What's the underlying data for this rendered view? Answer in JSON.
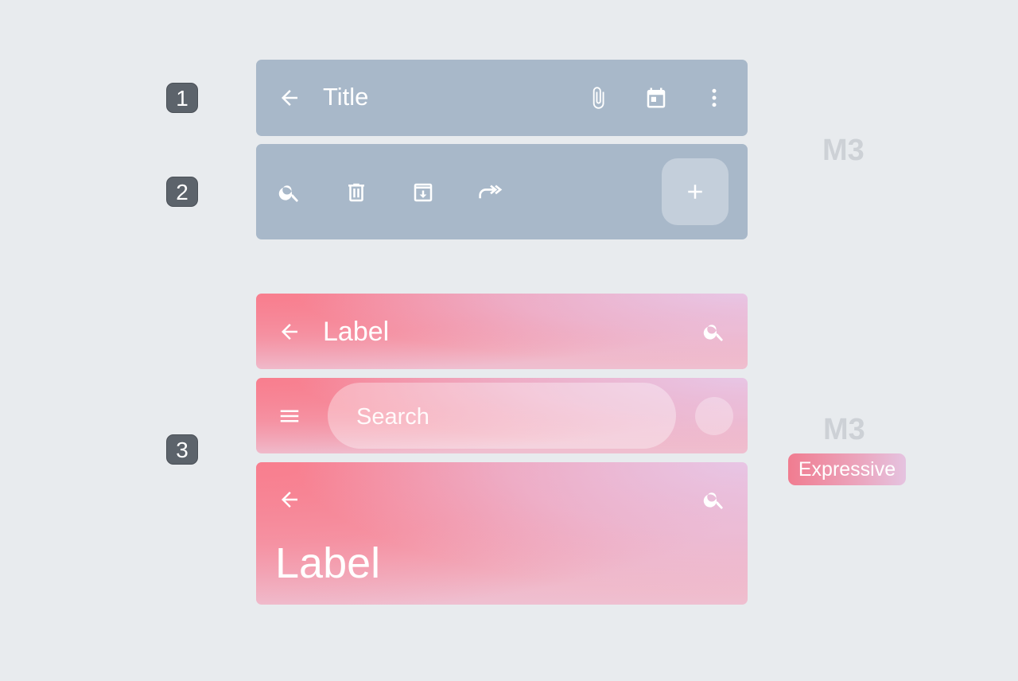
{
  "badges": [
    "1",
    "2",
    "3"
  ],
  "toolbar1": {
    "title": "Title",
    "icons": [
      "arrow-back-icon",
      "attach-icon",
      "calendar-icon",
      "more-vert-icon"
    ]
  },
  "toolbar2": {
    "icons": [
      "search-icon",
      "delete-icon",
      "archive-icon",
      "forward-icon",
      "add-icon"
    ]
  },
  "expressive": {
    "top_bar": {
      "title": "Label"
    },
    "search_bar": {
      "placeholder": "Search"
    },
    "large_bar": {
      "title": "Label"
    }
  },
  "labels": {
    "m3_top": "M3",
    "m3_bottom": "M3",
    "expressive": "Expressive"
  },
  "colors": {
    "background": "#e8ebee",
    "m3_bar": "#a8b8c9",
    "badge": "#5c636b",
    "expressive_pink": "#f87e8e",
    "expressive_lilac": "#e7c8e8"
  }
}
